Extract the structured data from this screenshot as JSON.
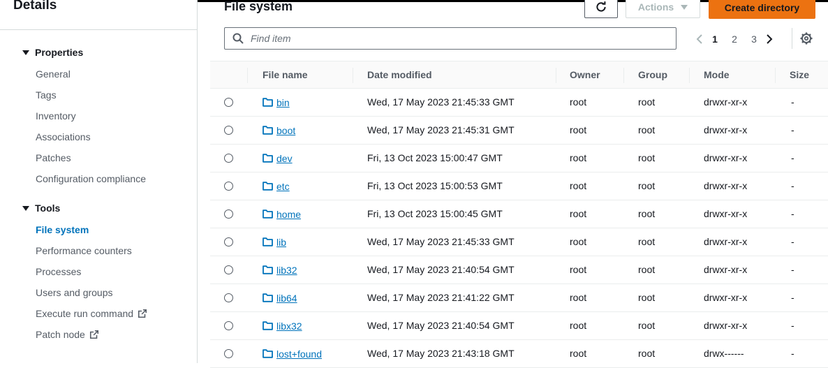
{
  "sidebar": {
    "title": "Details",
    "sections": [
      {
        "label": "Properties",
        "items": [
          "General",
          "Tags",
          "Inventory",
          "Associations",
          "Patches",
          "Configuration compliance"
        ]
      },
      {
        "label": "Tools",
        "items": [
          "File system",
          "Performance counters",
          "Processes",
          "Users and groups",
          "Execute run command",
          "Patch node"
        ]
      }
    ],
    "active_item": "File system"
  },
  "main": {
    "title": "File system",
    "actions_label": "Actions",
    "create_label": "Create directory",
    "search_placeholder": "Find item",
    "pages": [
      "1",
      "2",
      "3"
    ],
    "current_page": "1"
  },
  "table": {
    "columns": [
      "File name",
      "Date modified",
      "Owner",
      "Group",
      "Mode",
      "Size"
    ],
    "rows": [
      {
        "name": "bin",
        "date": "Wed, 17 May 2023 21:45:33 GMT",
        "owner": "root",
        "group": "root",
        "mode": "drwxr-xr-x",
        "size": "-"
      },
      {
        "name": "boot",
        "date": "Wed, 17 May 2023 21:45:31 GMT",
        "owner": "root",
        "group": "root",
        "mode": "drwxr-xr-x",
        "size": "-"
      },
      {
        "name": "dev",
        "date": "Fri, 13 Oct 2023 15:00:47 GMT",
        "owner": "root",
        "group": "root",
        "mode": "drwxr-xr-x",
        "size": "-"
      },
      {
        "name": "etc",
        "date": "Fri, 13 Oct 2023 15:00:53 GMT",
        "owner": "root",
        "group": "root",
        "mode": "drwxr-xr-x",
        "size": "-"
      },
      {
        "name": "home",
        "date": "Fri, 13 Oct 2023 15:00:45 GMT",
        "owner": "root",
        "group": "root",
        "mode": "drwxr-xr-x",
        "size": "-"
      },
      {
        "name": "lib",
        "date": "Wed, 17 May 2023 21:45:33 GMT",
        "owner": "root",
        "group": "root",
        "mode": "drwxr-xr-x",
        "size": "-"
      },
      {
        "name": "lib32",
        "date": "Wed, 17 May 2023 21:40:54 GMT",
        "owner": "root",
        "group": "root",
        "mode": "drwxr-xr-x",
        "size": "-"
      },
      {
        "name": "lib64",
        "date": "Wed, 17 May 2023 21:41:22 GMT",
        "owner": "root",
        "group": "root",
        "mode": "drwxr-xr-x",
        "size": "-"
      },
      {
        "name": "libx32",
        "date": "Wed, 17 May 2023 21:40:54 GMT",
        "owner": "root",
        "group": "root",
        "mode": "drwxr-xr-x",
        "size": "-"
      },
      {
        "name": "lost+found",
        "date": "Wed, 17 May 2023 21:43:18 GMT",
        "owner": "root",
        "group": "root",
        "mode": "drwx------",
        "size": "-"
      }
    ]
  },
  "colors": {
    "accent": "#0073bb",
    "primary_button": "#ec7211",
    "text": "#16191f",
    "muted": "#545b64"
  },
  "icons": {
    "refresh": "refresh-icon",
    "folder": "folder-icon",
    "search": "search-icon",
    "settings": "gear-icon",
    "external": "external-link-icon"
  }
}
